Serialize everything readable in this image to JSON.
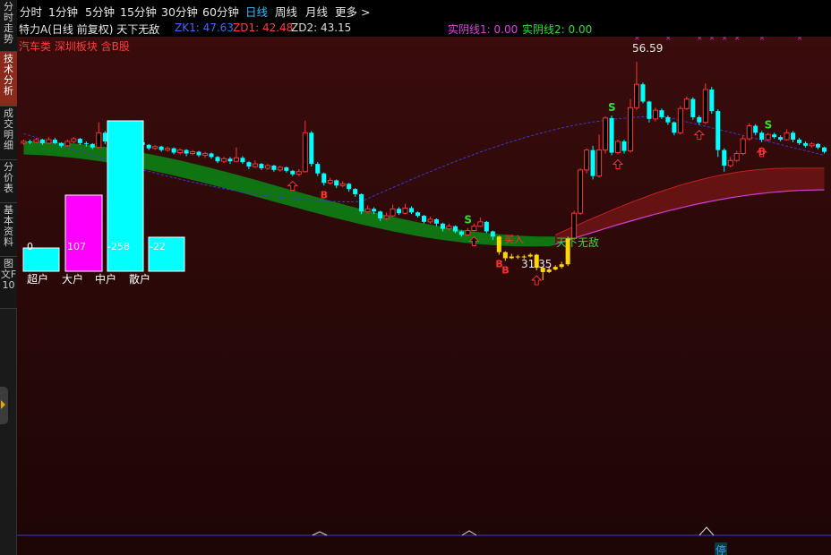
{
  "sidebar": {
    "tabs": [
      {
        "label": "分时走势",
        "active": false
      },
      {
        "label": "技术分析",
        "active": true
      },
      {
        "label": "成交明细",
        "active": false
      },
      {
        "label": "分价表",
        "active": false
      },
      {
        "label": "基本资料",
        "active": false
      },
      {
        "label": "图文F10",
        "active": false
      }
    ]
  },
  "menu": {
    "items": [
      {
        "label": "分时",
        "active": false
      },
      {
        "label": "1分钟",
        "active": false
      },
      {
        "label": "5分钟",
        "active": false
      },
      {
        "label": "15分钟",
        "active": false
      },
      {
        "label": "30分钟",
        "active": false
      },
      {
        "label": "60分钟",
        "active": false
      },
      {
        "label": "日线",
        "active": true
      },
      {
        "label": "周线",
        "active": false
      },
      {
        "label": "月线",
        "active": false
      },
      {
        "label": "更多 >",
        "active": false
      }
    ]
  },
  "info": {
    "title": "特力A(日线 前复权) 天下无敌",
    "zk1": "ZK1: 47.63",
    "zd1": "ZD1: 42.48",
    "zd2": "ZD2: 43.15",
    "shiyin1": "实阴线1: 0.00",
    "shiyin2": "实阴线2: 0.00"
  },
  "sector": "汽车类 深圳板块 含B股",
  "funds": {
    "categories": [
      "超户",
      "大户",
      "中户",
      "散户"
    ],
    "values": [
      "0",
      "107",
      "-258",
      "-22"
    ],
    "colors": [
      "#00ffff",
      "#ff00ff",
      "#00ffff",
      "#00ffff"
    ]
  },
  "annotations": {
    "high": "56.59",
    "low": "31.35",
    "signal": "天下无敌",
    "buy_text": "买入",
    "stop": "停"
  },
  "colors": {
    "background": "#3a0c0c",
    "up": "#ff3232",
    "down": "#00ffff",
    "band_fill": "#0f7a14",
    "band_fill_red": "#6e1414",
    "upper_line": "#3a3ac8",
    "lower_line": "#d23cd2"
  },
  "chart_data": {
    "type": "candlestick",
    "title": "特力A(日线 前复权)",
    "price_range": [
      29.5,
      59.5
    ],
    "labeled_high": 56.59,
    "labeled_low": 31.35,
    "candles": [
      [
        47.2,
        47.4,
        47.6,
        47.0
      ],
      [
        47.4,
        47.3,
        47.6,
        47.1
      ],
      [
        47.3,
        47.6,
        47.8,
        47.2
      ],
      [
        47.6,
        47.2,
        47.7,
        47.0
      ],
      [
        47.2,
        47.6,
        47.9,
        47.1
      ],
      [
        47.6,
        47.2,
        47.8,
        47.1
      ],
      [
        47.2,
        46.9,
        47.3,
        46.7
      ],
      [
        46.9,
        47.4,
        47.6,
        46.8
      ],
      [
        47.4,
        47.7,
        47.9,
        47.2
      ],
      [
        47.7,
        47.2,
        47.8,
        47.0
      ],
      [
        47.2,
        47.1,
        47.4,
        46.8
      ],
      [
        47.1,
        46.7,
        47.2,
        46.5
      ],
      [
        46.7,
        48.4,
        49.6,
        46.6
      ],
      [
        48.4,
        47.4,
        48.6,
        47.1
      ],
      [
        47.4,
        47.2,
        47.6,
        47.0
      ],
      [
        47.2,
        46.8,
        47.3,
        46.6
      ],
      [
        46.8,
        47.2,
        47.5,
        46.7
      ],
      [
        47.2,
        46.9,
        47.4,
        46.7
      ],
      [
        46.9,
        47.3,
        47.6,
        46.8
      ],
      [
        47.3,
        47.0,
        47.5,
        46.8
      ],
      [
        47.0,
        46.6,
        47.1,
        46.4
      ],
      [
        46.6,
        46.8,
        47.0,
        46.4
      ],
      [
        46.8,
        46.4,
        46.9,
        46.2
      ],
      [
        46.4,
        46.6,
        46.8,
        46.2
      ],
      [
        46.6,
        46.1,
        46.7,
        45.9
      ],
      [
        46.1,
        46.4,
        46.6,
        45.9
      ],
      [
        46.4,
        46.0,
        46.5,
        45.7
      ],
      [
        46.0,
        46.2,
        46.4,
        45.8
      ],
      [
        46.2,
        45.8,
        46.3,
        45.6
      ],
      [
        45.8,
        46.0,
        46.2,
        45.5
      ],
      [
        46.0,
        45.6,
        46.1,
        45.4
      ],
      [
        45.6,
        45.1,
        45.7,
        44.9
      ],
      [
        45.1,
        45.4,
        45.6,
        44.9
      ],
      [
        45.4,
        45.1,
        45.6,
        44.8
      ],
      [
        45.1,
        45.5,
        46.7,
        45.0
      ],
      [
        45.5,
        45.0,
        45.7,
        44.8
      ],
      [
        45.0,
        44.5,
        45.1,
        44.2
      ],
      [
        44.5,
        44.8,
        45.2,
        44.3
      ],
      [
        44.8,
        44.3,
        44.9,
        44.1
      ],
      [
        44.3,
        44.6,
        44.8,
        44.1
      ],
      [
        44.6,
        44.1,
        44.7,
        43.9
      ],
      [
        44.1,
        44.4,
        44.6,
        43.9
      ],
      [
        44.4,
        44.0,
        44.5,
        43.8
      ],
      [
        44.0,
        43.6,
        44.1,
        43.4
      ],
      [
        43.6,
        43.9,
        44.2,
        43.4
      ],
      [
        43.9,
        48.4,
        49.8,
        43.8
      ],
      [
        48.4,
        44.8,
        48.6,
        44.5
      ],
      [
        44.8,
        43.7,
        45.0,
        43.4
      ],
      [
        43.7,
        42.6,
        43.8,
        42.3
      ],
      [
        42.6,
        42.9,
        43.2,
        42.4
      ],
      [
        42.9,
        42.3,
        43.0,
        42.0
      ],
      [
        42.3,
        42.5,
        42.8,
        42.1
      ],
      [
        42.5,
        41.9,
        42.6,
        41.6
      ],
      [
        41.9,
        41.3,
        42.0,
        41.0
      ],
      [
        41.3,
        39.3,
        41.4,
        39.0
      ],
      [
        39.3,
        39.6,
        40.0,
        39.1
      ],
      [
        39.6,
        39.3,
        39.8,
        39.0
      ],
      [
        39.3,
        38.5,
        39.4,
        38.2
      ],
      [
        38.5,
        38.8,
        39.2,
        38.3
      ],
      [
        38.8,
        39.6,
        40.1,
        38.7
      ],
      [
        39.6,
        39.1,
        39.8,
        38.9
      ],
      [
        39.1,
        39.7,
        40.2,
        39.0
      ],
      [
        39.7,
        39.2,
        39.9,
        39.0
      ],
      [
        39.2,
        38.8,
        39.3,
        38.6
      ],
      [
        38.8,
        38.1,
        38.9,
        37.9
      ],
      [
        38.1,
        38.4,
        38.7,
        37.9
      ],
      [
        38.4,
        37.9,
        38.5,
        37.6
      ],
      [
        37.9,
        37.3,
        38.0,
        37.0
      ],
      [
        37.3,
        37.6,
        37.9,
        37.1
      ],
      [
        37.6,
        37.0,
        37.7,
        36.8
      ],
      [
        37.0,
        36.6,
        37.1,
        36.4
      ],
      [
        36.6,
        37.1,
        37.4,
        36.5
      ],
      [
        37.1,
        37.6,
        37.9,
        37.0
      ],
      [
        37.6,
        38.1,
        38.6,
        37.5
      ],
      [
        38.1,
        37.0,
        38.2,
        36.8
      ],
      [
        37.0,
        36.4,
        37.1,
        36.0
      ],
      [
        36.4,
        34.6,
        36.5,
        34.3
      ],
      [
        34.6,
        33.9,
        34.7,
        33.6
      ],
      [
        33.9,
        34.1,
        34.4,
        33.8
      ],
      [
        34.1,
        34.0,
        34.3,
        33.8
      ],
      [
        34.0,
        34.1,
        34.3,
        33.8
      ],
      [
        34.1,
        34.3,
        34.5,
        34.0
      ],
      [
        34.3,
        32.8,
        34.4,
        32.5
      ],
      [
        32.8,
        32.3,
        32.9,
        31.35
      ],
      [
        32.3,
        32.6,
        32.9,
        32.2
      ],
      [
        32.6,
        32.9,
        33.1,
        32.5
      ],
      [
        32.9,
        33.2,
        33.5,
        32.7
      ],
      [
        33.2,
        36.2,
        36.4,
        33.0
      ],
      [
        36.2,
        39.1,
        39.4,
        36.0
      ],
      [
        39.1,
        44.1,
        44.3,
        38.9
      ],
      [
        44.1,
        46.4,
        46.6,
        43.7
      ],
      [
        46.4,
        43.4,
        46.9,
        43.0
      ],
      [
        43.4,
        46.4,
        48.2,
        43.2
      ],
      [
        46.4,
        50.1,
        50.3,
        46.0
      ],
      [
        50.1,
        46.1,
        50.4,
        45.8
      ],
      [
        46.1,
        47.4,
        47.6,
        45.9
      ],
      [
        47.4,
        46.3,
        47.6,
        46.0
      ],
      [
        46.3,
        51.3,
        52.3,
        46.1
      ],
      [
        51.3,
        54.0,
        56.59,
        51.0
      ],
      [
        54.0,
        52.0,
        54.2,
        51.8
      ],
      [
        52.0,
        50.0,
        52.1,
        49.6
      ],
      [
        50.0,
        51.0,
        51.3,
        49.7
      ],
      [
        51.0,
        50.2,
        51.2,
        50.0
      ],
      [
        50.2,
        49.6,
        50.4,
        49.3
      ],
      [
        49.6,
        48.4,
        49.7,
        48.1
      ],
      [
        48.4,
        51.2,
        51.5,
        48.2
      ],
      [
        51.2,
        52.3,
        52.6,
        51.0
      ],
      [
        52.3,
        50.2,
        52.5,
        49.9
      ],
      [
        50.2,
        49.6,
        50.4,
        49.3
      ],
      [
        49.6,
        53.4,
        54.1,
        49.4
      ],
      [
        53.4,
        50.9,
        53.7,
        50.6
      ],
      [
        50.9,
        46.4,
        51.1,
        45.6
      ],
      [
        46.4,
        44.6,
        46.6,
        43.9
      ],
      [
        44.6,
        45.2,
        45.6,
        44.4
      ],
      [
        45.2,
        46.0,
        46.3,
        45.0
      ],
      [
        46.0,
        47.7,
        48.1,
        45.8
      ],
      [
        47.7,
        49.2,
        49.5,
        47.5
      ],
      [
        49.2,
        48.4,
        49.4,
        48.1
      ],
      [
        48.4,
        47.6,
        48.6,
        47.3
      ],
      [
        47.6,
        48.2,
        48.4,
        47.4
      ],
      [
        48.2,
        47.9,
        48.4,
        47.7
      ],
      [
        47.9,
        47.6,
        48.1,
        47.4
      ],
      [
        47.6,
        48.4,
        48.8,
        47.5
      ],
      [
        48.4,
        47.6,
        48.6,
        47.3
      ],
      [
        47.6,
        47.2,
        47.8,
        47.0
      ],
      [
        47.2,
        46.9,
        47.4,
        46.7
      ],
      [
        46.9,
        47.1,
        47.3,
        46.7
      ],
      [
        47.1,
        46.7,
        47.2,
        46.5
      ],
      [
        46.7,
        46.2,
        46.8,
        46.0
      ]
    ]
  }
}
